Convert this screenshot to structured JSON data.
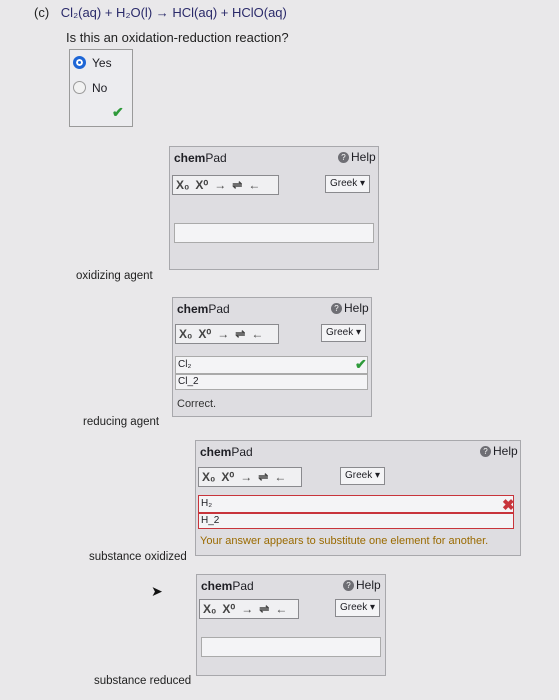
{
  "question": {
    "part": "(c)",
    "equation": "Cl₂(aq) + H₂O(l) → HCl(aq) + HClO(aq)",
    "prompt": "Is this an oxidation-reduction reaction?",
    "choices": [
      {
        "label": "Yes",
        "selected": true
      },
      {
        "label": "No",
        "selected": false
      }
    ]
  },
  "labels": {
    "oxidizing_agent": "oxidizing agent",
    "reducing_agent": "reducing agent",
    "substance_oxidized": "substance oxidized",
    "substance_reduced": "substance reduced"
  },
  "chempad": {
    "title_bold": "chem",
    "title_rest": "Pad",
    "help": "Help",
    "greek": "Greek",
    "toolbar": [
      "X₀",
      "X⁰",
      "→",
      "⇌",
      "←"
    ]
  },
  "answers": {
    "oxidizing": {
      "rendered": "Cl₂",
      "raw": "Cl_2",
      "feedback": "Correct."
    },
    "reducing": {
      "rendered": "H₂",
      "raw": "H_2",
      "feedback": "Your answer appears to substitute one element for another."
    }
  },
  "colors": {
    "correct": "#2e9a3a",
    "incorrect": "#c8343b",
    "accent": "#1e66d6"
  }
}
